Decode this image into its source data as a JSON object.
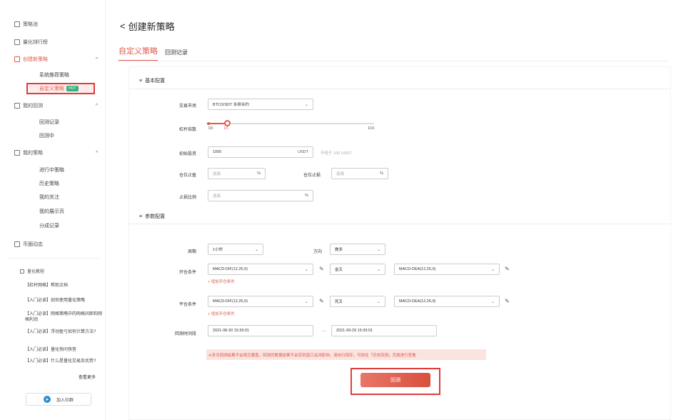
{
  "sidebar": {
    "items": [
      {
        "label": "策略池",
        "icon": "strategy-pool-icon"
      },
      {
        "label": "量化排行榜",
        "icon": "ranking-icon"
      },
      {
        "label": "创建新策略",
        "icon": "create-icon",
        "chevron": "^"
      },
      {
        "label": "我的回测",
        "icon": "backtest-icon",
        "chevron": "^"
      },
      {
        "label": "我的策略",
        "icon": "my-strategy-icon",
        "chevron": "^"
      },
      {
        "label": "币圈动态",
        "icon": "news-icon"
      }
    ],
    "create_sub": [
      "系统推荐策略",
      "自定义策略"
    ],
    "hot_badge": "HOT",
    "backtest_sub": [
      "回测记录",
      "回测中"
    ],
    "strategy_sub": [
      "进行中策略",
      "历史策略",
      "我的关注",
      "我的展示页",
      "分成记录"
    ],
    "help_title": "量化教程",
    "help_items": [
      "【杠杆网格】帮助文档",
      "【入门必读】如何使用量化策略",
      "【入门必读】网格策略中的网格间距和网格利润",
      "【入门必读】浮动盈亏如何计算方法?",
      "【入门必读】量化快问快答",
      "【入门必读】什么是量化交易及优势?"
    ],
    "more": "查看更多",
    "join": "加入社群"
  },
  "main": {
    "back": "<",
    "title": "创建新策略",
    "tab_active": "自定义策略",
    "tab_other": "回测记录",
    "section_basic": "基本配置",
    "section_param": "参数配置",
    "market_label": "交易市场",
    "market_value": "BTC/USDT 永续合约",
    "leverage_label": "杠杆倍数",
    "leverage_min": "0X",
    "leverage_cur": "1X",
    "leverage_max": "10X",
    "leverage_level": 0.1,
    "capital_label": "初始投资",
    "capital_value": "1000",
    "capital_unit": "USDT",
    "capital_note": "不低于 100 USDT",
    "pos_stop_loss_label": "仓位止盈",
    "pos_stop_loss_ph": "选填",
    "pos_take_profit_label": "仓位止损",
    "pos_take_profit_ph": "选填",
    "pct": "%",
    "stop_ratio_label": "止损比例",
    "stop_ratio_ph": "选填",
    "period_label": "周期",
    "period_value": "1小时",
    "direction_label": "方向",
    "direction_value": "做多",
    "open_label": "开仓条件",
    "open_left": "MACD-DIF(12,26,9)",
    "open_op": "金叉",
    "open_right": "MACD-DEA(12,26,9)",
    "open_add": "+ 增加开仓条件",
    "close_label": "平仓条件",
    "close_left": "MACD-DIF(12,26,9)",
    "close_op": "死叉",
    "close_right": "MACD-DEA(12,26,9)",
    "close_add": "+ 增加平仓条件",
    "time_label": "回测时间段",
    "time_start": "2021-08-30 15:39:01",
    "time_sep": "—",
    "time_end": "2021-09-29 15:39:01",
    "warning": "※多次回测结果不会相互覆盖，回测的数据结果不会受到窗口关闭影响，请自行保存，可前往「历史回测」页面进行查看",
    "run": "回测"
  }
}
